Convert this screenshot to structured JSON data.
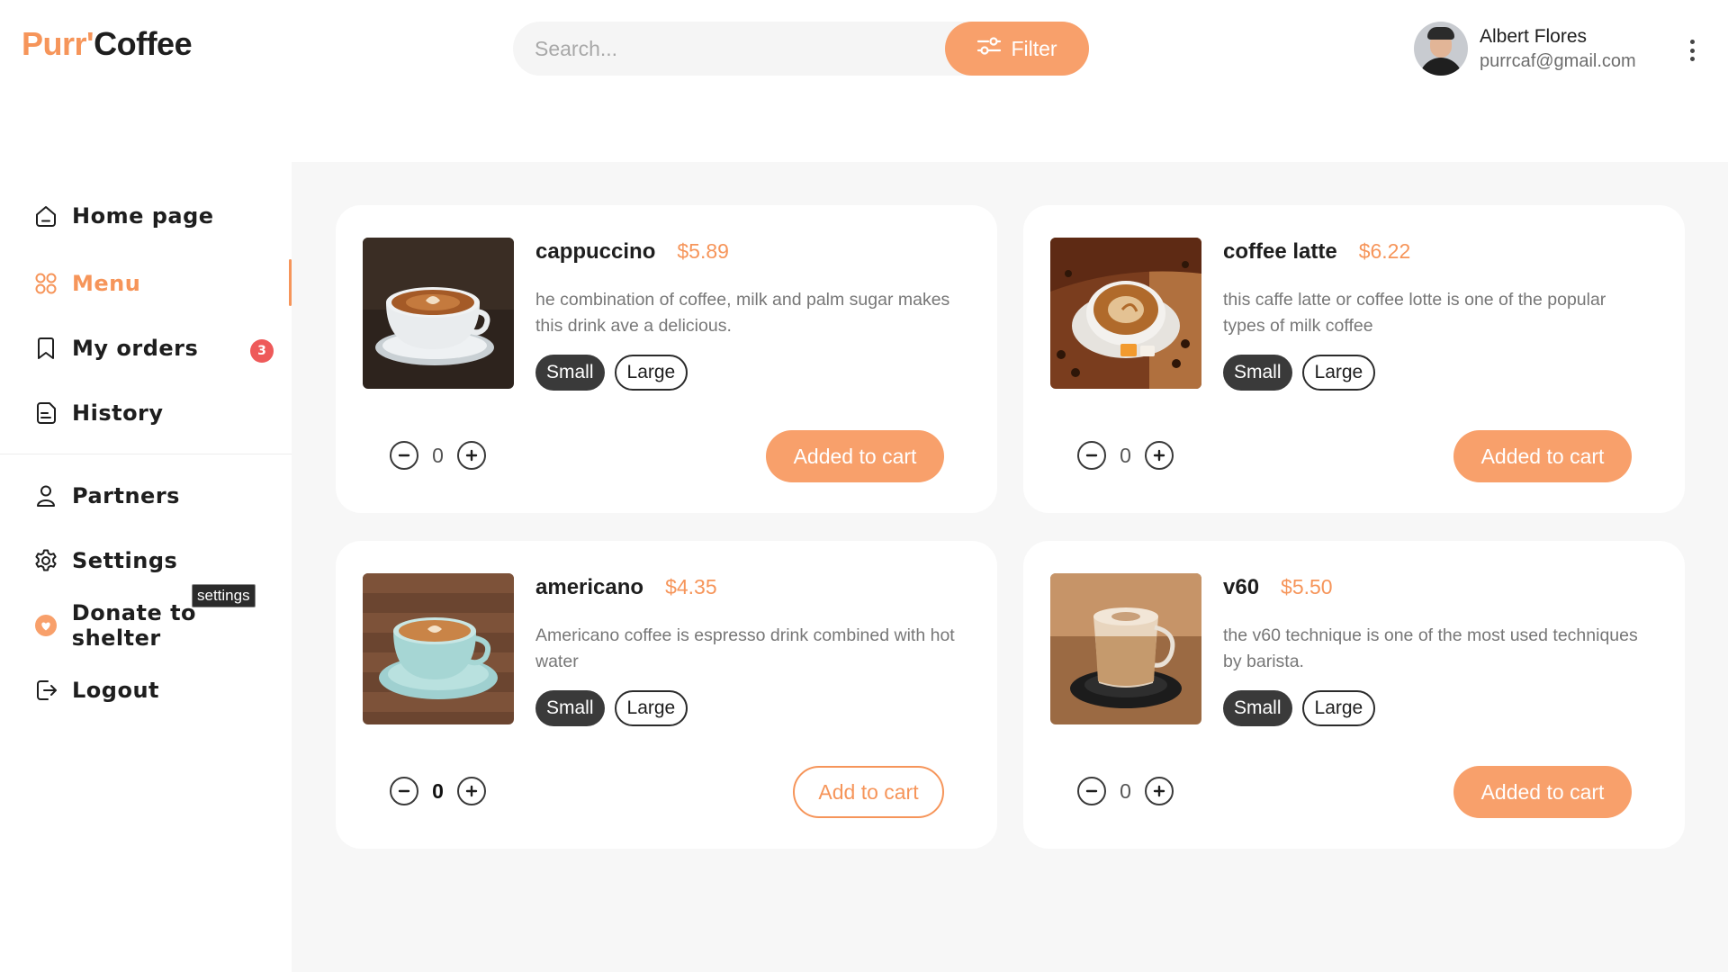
{
  "brand": {
    "part1": "Purr'",
    "part2": "Coffee",
    "accent": "#f6955a"
  },
  "search": {
    "placeholder": "Search..."
  },
  "filter": {
    "label": "Filter",
    "icon": "sliders-icon"
  },
  "user": {
    "name": "Albert Flores",
    "email": "purrcaf@gmail.com"
  },
  "sidebar": {
    "items": [
      {
        "label": "Home page",
        "icon": "home-icon"
      },
      {
        "label": "Menu",
        "icon": "grid-icon",
        "active": true
      },
      {
        "label": "My orders",
        "icon": "bookmark-icon",
        "badge": "3"
      },
      {
        "label": "History",
        "icon": "document-icon"
      },
      {
        "label": "Partners",
        "icon": "user-icon"
      },
      {
        "label": "Settings",
        "icon": "gear-icon"
      },
      {
        "label": "Donate to shelter",
        "icon": "heart-icon"
      },
      {
        "label": "Logout",
        "icon": "logout-icon"
      }
    ],
    "tooltip": "settings"
  },
  "products": [
    {
      "name": "cappuccino",
      "price": "$5.89",
      "description": "he combination of coffee, milk and palm sugar makes this drink ave a delicious.",
      "sizes": [
        "Small",
        "Large"
      ],
      "selected_size": "Small",
      "quantity": "0",
      "button": "Added to cart",
      "in_cart": true
    },
    {
      "name": "coffee latte",
      "price": "$6.22",
      "description": "this caffe latte or coffee lotte is one of the popular types of milk coffee",
      "sizes": [
        "Small",
        "Large"
      ],
      "selected_size": "Small",
      "quantity": "0",
      "button": "Added to cart",
      "in_cart": true
    },
    {
      "name": "americano",
      "price": "$4.35",
      "description": "Americano coffee is espresso drink combined with hot water",
      "sizes": [
        "Small",
        "Large"
      ],
      "selected_size": "Small",
      "quantity": "0",
      "button": "Add to cart",
      "in_cart": false
    },
    {
      "name": "v60",
      "price": "$5.50",
      "description": "the v60 technique is one of the most used techniques by barista.",
      "sizes": [
        "Small",
        "Large"
      ],
      "selected_size": "Small",
      "quantity": "0",
      "button": "Added to cart",
      "in_cart": true
    }
  ]
}
